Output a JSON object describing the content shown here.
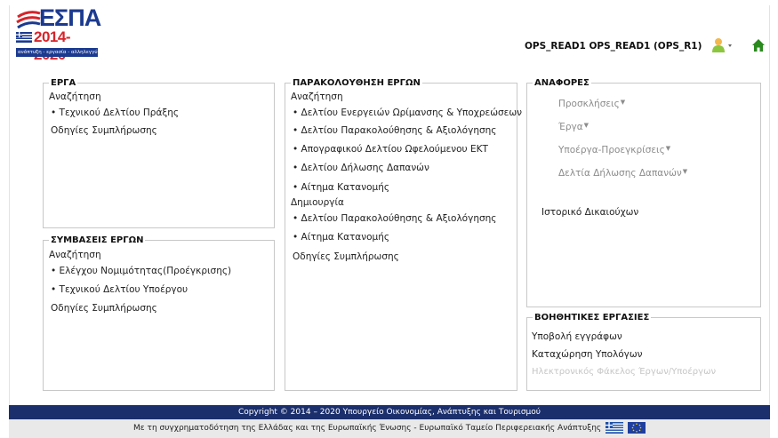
{
  "header": {
    "logo": {
      "wordmark": "ΕΣΠΑ",
      "years": "2014-2020",
      "tagline": "ανάπτυξη - εργασία - αλληλεγγύη"
    },
    "user_label": "OPS_READ1 OPS_READ1 (OPS_R1)",
    "user_icon": "user-icon",
    "home_icon": "home-icon",
    "colors": {
      "brand_blue": "#1b3a8f",
      "brand_red": "#d6242a",
      "home_green": "#2a8a1e",
      "user_green": "#8cc63f"
    }
  },
  "erga": {
    "title": "ΕΡΓΑ",
    "search_heading": "Αναζήτηση",
    "search_items": [
      "• Τεχνικού Δελτίου Πράξης"
    ],
    "instructions": "Οδηγίες Συμπλήρωσης"
  },
  "symvaseis": {
    "title": "ΣΥΜΒΑΣΕΙΣ ΕΡΓΩΝ",
    "search_heading": "Αναζήτηση",
    "search_items": [
      "• Ελέγχου Νομιμότητας(Προέγκρισης)",
      "• Τεχνικού Δελτίου Υποέργου"
    ],
    "instructions": "Οδηγίες Συμπλήρωσης"
  },
  "parakolouthisi": {
    "title": "ΠΑΡΑΚΟΛΟΥΘΗΣΗ ΕΡΓΩΝ",
    "search_heading": "Αναζήτηση",
    "search_items": [
      "• Δελτίου Ενεργειών Ωρίμανσης & Υποχρεώσεων",
      "• Δελτίου Παρακολούθησης & Αξιολόγησης",
      "• Απογραφικού Δελτίου Ωφελούμενου ΕΚΤ",
      "• Δελτίου Δήλωσης Δαπανών",
      "• Αίτημα Κατανομής"
    ],
    "create_heading": "Δημιουργία",
    "create_items": [
      "• Δελτίου Παρακολούθησης & Αξιολόγησης",
      "• Αίτημα Κατανομής"
    ],
    "instructions": "Οδηγίες Συμπλήρωσης"
  },
  "anafores": {
    "title": "ΑΝΑΦΟΡΕΣ",
    "menus": [
      "Προσκλήσεις",
      "Έργα",
      "Υποέργα-Προεγκρίσεις",
      "Δελτία Δήλωσης Δαπανών"
    ],
    "history": "Ιστορικό Δικαιούχων"
  },
  "voithitikes": {
    "title": "ΒΟΗΘΗΤΙΚΕΣ ΕΡΓΑΣΙΕΣ",
    "items": [
      "Υποβολή εγγράφων",
      "Καταχώρηση Υπολόγων"
    ],
    "disabled_item": "Ηλεκτρονικός Φάκελος Έργων/Υποέργων"
  },
  "footer": {
    "copyright": "Copyright © 2014 – 2020 Υπουργείο Οικονομίας, Ανάπτυξης και Τουρισμού",
    "funding": "Με τη συγχρηματοδότηση της Ελλάδας και της Ευρωπαϊκής Ένωσης - Ευρωπαϊκό Ταμείο Περιφερειακής Ανάπτυξης",
    "flag_icons": [
      "greek-flag-icon",
      "eu-flag-icon"
    ]
  }
}
